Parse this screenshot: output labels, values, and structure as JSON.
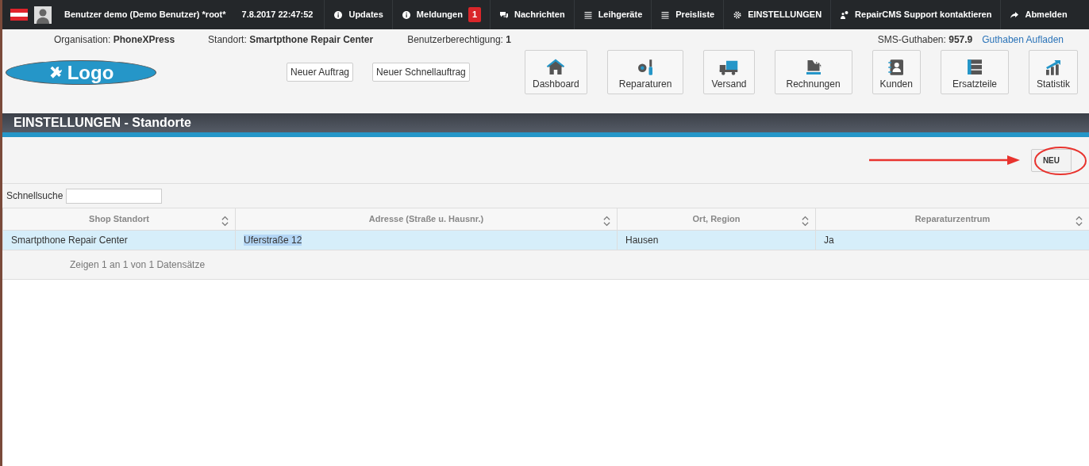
{
  "topbar": {
    "user": "Benutzer demo (Demo Benutzer) *root*",
    "datetime": "7.8.2017 22:47:52",
    "items": [
      {
        "label": "Updates"
      },
      {
        "label": "Meldungen",
        "badge": "1"
      },
      {
        "label": "Nachrichten"
      },
      {
        "label": "Leihgeräte"
      },
      {
        "label": "Preisliste"
      },
      {
        "label": "EINSTELLUNGEN"
      },
      {
        "label": "RepairCMS Support kontaktieren"
      },
      {
        "label": "Abmelden"
      }
    ]
  },
  "info": [
    "Organisation: **PhoneXPress**",
    "Standort: **Smartpthone Repair Center**",
    "Benutzerberechtigung: **1**"
  ],
  "sms": {
    "text": "SMS-Guthaben: **957.9**",
    "link": "Guthaben Aufladen"
  },
  "logo": "Logo",
  "quick_buttons": [
    "Neuer Auftrag",
    "Neuer Schnellauftrag"
  ],
  "modules": [
    {
      "label": "Dashboard"
    },
    {
      "label": "Reparaturen"
    },
    {
      "label": "Versand"
    },
    {
      "label": "Rechnungen"
    },
    {
      "label": "Kunden"
    },
    {
      "label": "Ersatzteile"
    },
    {
      "label": "Statistik"
    }
  ],
  "section_title": "EINSTELLUNGEN - Standorte",
  "new_button": "NEU",
  "search": {
    "label": "Schnellsuche"
  },
  "table": {
    "columns": [
      "Shop Standort",
      "Adresse (Straße u. Hausnr.)",
      "Ort, Region",
      "Reparaturzentrum"
    ],
    "rows": [
      {
        "selected": true,
        "cells": [
          {
            "text": "Smartpthone Repair Center",
            "highlighted": false
          },
          {
            "text": "Uferstraße 12",
            "highlighted": true
          },
          {
            "text": "Hausen",
            "highlighted": false
          },
          {
            "text": "Ja",
            "highlighted": false
          }
        ]
      }
    ],
    "footer": "Zeigen 1 an 1 von 1 Datensätze"
  }
}
